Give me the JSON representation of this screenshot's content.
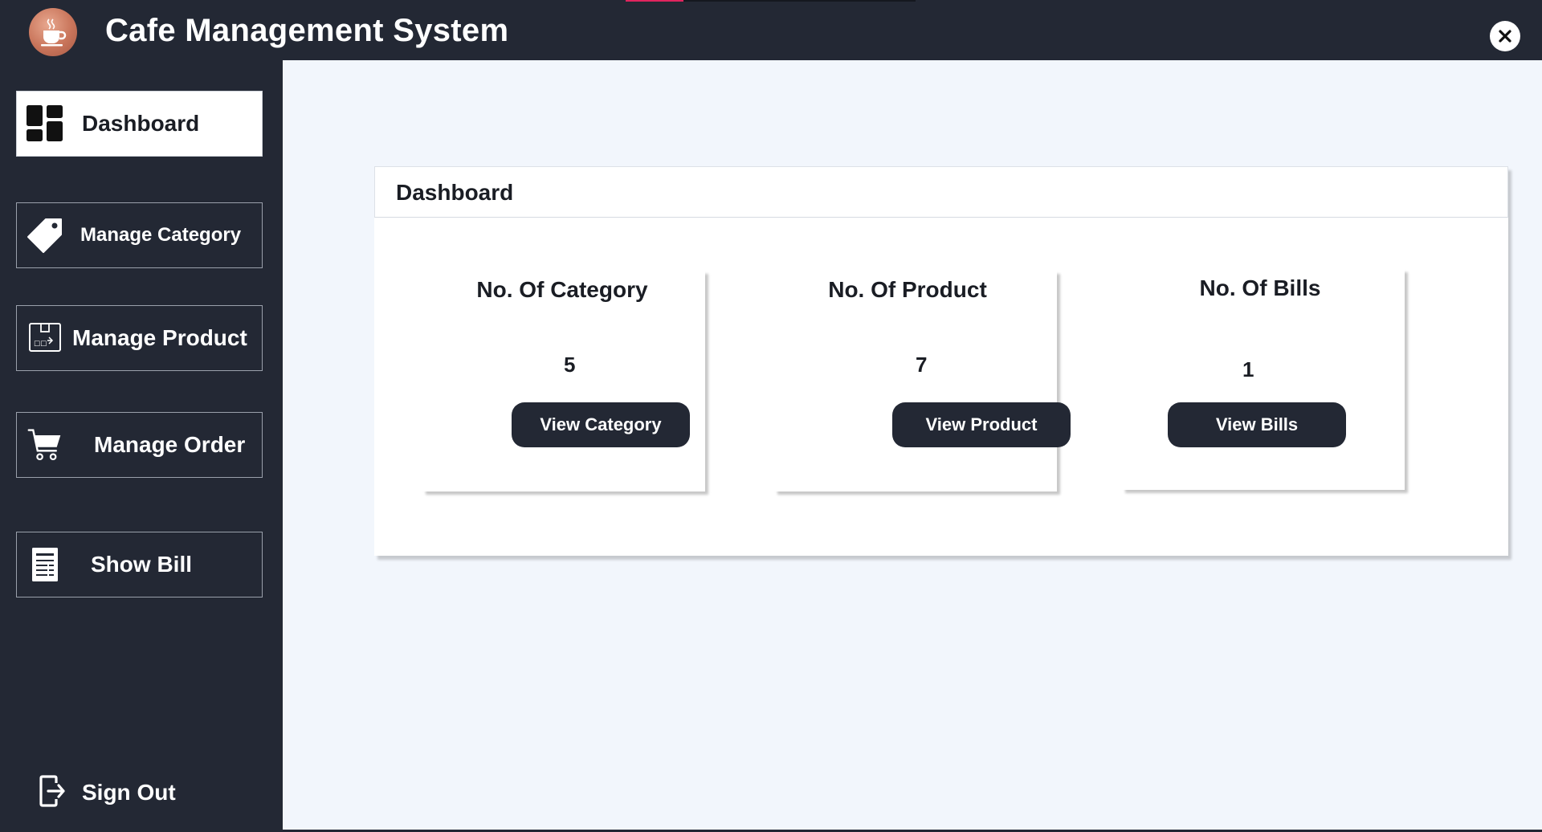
{
  "app": {
    "title": "Cafe Management System",
    "logo_icon": "coffee-cup-icon",
    "close_icon": "close-icon"
  },
  "sidebar": {
    "items": [
      {
        "label": "Dashboard",
        "icon": "dashboard-grid-icon",
        "active": true
      },
      {
        "label": "Manage Category",
        "icon": "tag-icon",
        "active": false
      },
      {
        "label": "Manage Product",
        "icon": "product-box-icon",
        "active": false
      },
      {
        "label": "Manage Order",
        "icon": "cart-icon",
        "active": false
      },
      {
        "label": "Show Bill",
        "icon": "bill-icon",
        "active": false
      }
    ],
    "signout": {
      "label": "Sign Out",
      "icon": "sign-out-icon"
    }
  },
  "dashboard": {
    "title": "Dashboard",
    "cards": [
      {
        "title": "No. Of Category",
        "value": "5",
        "button": "View Category"
      },
      {
        "title": "No. Of Product",
        "value": "7",
        "button": "View Product"
      },
      {
        "title": "No. Of Bills",
        "value": "1",
        "button": "View Bills"
      }
    ]
  },
  "colors": {
    "dark": "#232834",
    "main_bg": "#f2f6fc",
    "card_bg": "#ffffff",
    "accent": "#e0245e",
    "logo": "#c9755b"
  }
}
